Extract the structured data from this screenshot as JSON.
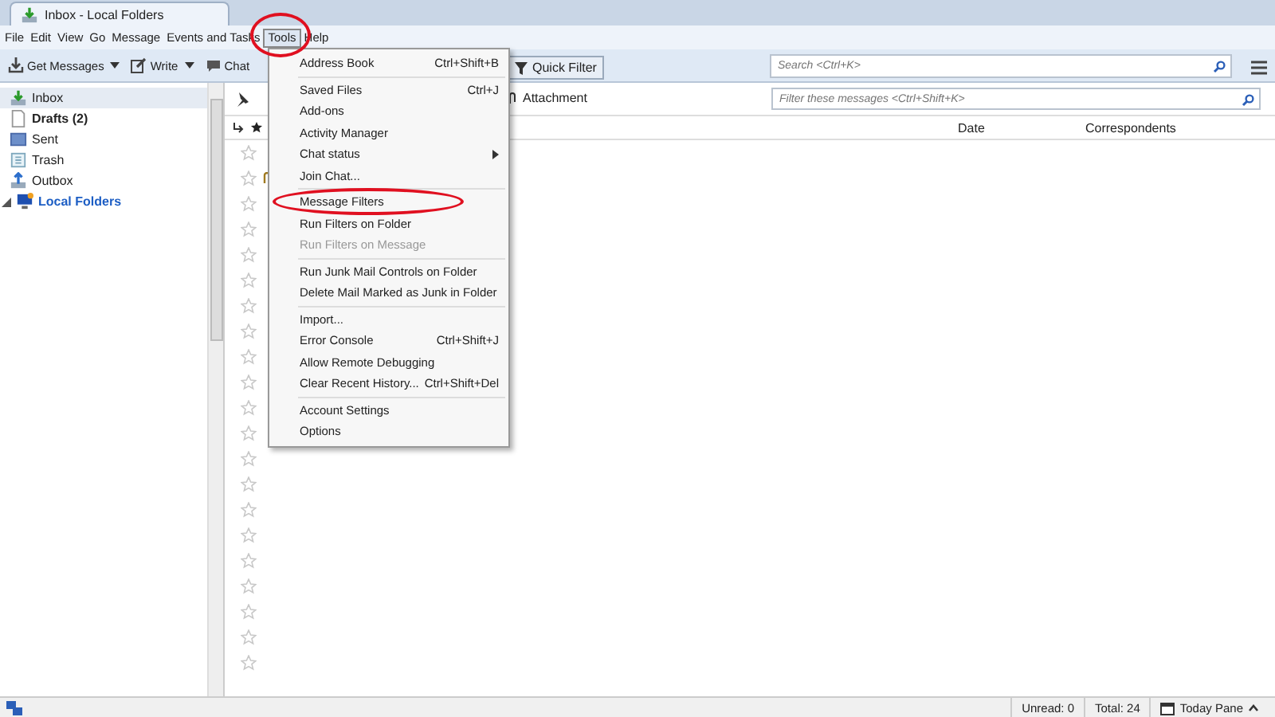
{
  "window": {
    "tab_title": "Inbox - Local Folders"
  },
  "menu_bar": [
    {
      "label": "File",
      "selected": false
    },
    {
      "label": "Edit",
      "selected": false
    },
    {
      "label": "View",
      "selected": false
    },
    {
      "label": "Go",
      "selected": false
    },
    {
      "label": "Message",
      "selected": false
    },
    {
      "label": "Events and Tasks",
      "selected": false
    },
    {
      "label": "Tools",
      "selected": true
    },
    {
      "label": "Help",
      "selected": false
    }
  ],
  "toolbar": {
    "buttons": [
      {
        "label": "Get Messages",
        "kind": "split"
      },
      {
        "label": "Write",
        "kind": "split"
      },
      {
        "label": "Chat",
        "kind": "plain"
      }
    ],
    "quick_filter": "Quick Filter",
    "search": {
      "placeholder": "Search <Ctrl+K>"
    }
  },
  "folders": [
    {
      "label": "Inbox",
      "selected": true,
      "bold": false
    },
    {
      "label": "Drafts (2)",
      "selected": false,
      "bold": true
    },
    {
      "label": "Sent",
      "selected": false,
      "bold": false
    },
    {
      "label": "Trash",
      "selected": false,
      "bold": false
    },
    {
      "label": "Outbox",
      "selected": false,
      "bold": false
    },
    {
      "label": "Local Folders",
      "selected": false,
      "bold": true,
      "expanded": true
    }
  ],
  "filter_bar": {
    "attachment": "Attachment",
    "filter": {
      "placeholder": "Filter these messages <Ctrl+Shift+K>"
    }
  },
  "columns": [
    {
      "label": "Date"
    },
    {
      "label": "Correspondents"
    }
  ],
  "message_rows": [
    {
      "starred": false,
      "attachment": false
    },
    {
      "starred": false,
      "attachment": true
    },
    {
      "starred": false,
      "attachment": false
    },
    {
      "starred": false,
      "attachment": false
    },
    {
      "starred": false,
      "attachment": false
    },
    {
      "starred": false,
      "attachment": false
    },
    {
      "starred": false,
      "attachment": false
    },
    {
      "starred": false,
      "attachment": false
    },
    {
      "starred": false,
      "attachment": false
    },
    {
      "starred": false,
      "attachment": false
    },
    {
      "starred": false,
      "attachment": false
    },
    {
      "starred": false,
      "attachment": false
    },
    {
      "starred": false,
      "attachment": false
    },
    {
      "starred": false,
      "attachment": false
    },
    {
      "starred": false,
      "attachment": false
    },
    {
      "starred": false,
      "attachment": false
    },
    {
      "starred": false,
      "attachment": false
    },
    {
      "starred": false,
      "attachment": false
    },
    {
      "starred": false,
      "attachment": false
    },
    {
      "starred": false,
      "attachment": false
    },
    {
      "starred": false,
      "attachment": false
    }
  ],
  "tools_menu": [
    {
      "label": "Address Book",
      "shortcut": "Ctrl+Shift+B",
      "disabled": false,
      "submenu": false,
      "highlighted": false,
      "separator_after": true
    },
    {
      "label": "Saved Files",
      "shortcut": "Ctrl+J",
      "disabled": false,
      "submenu": false,
      "highlighted": false,
      "separator_after": false
    },
    {
      "label": "Add-ons",
      "disabled": false,
      "submenu": false,
      "highlighted": false,
      "separator_after": false
    },
    {
      "label": "Activity Manager",
      "disabled": false,
      "submenu": false,
      "highlighted": false,
      "separator_after": false
    },
    {
      "label": "Chat status",
      "disabled": false,
      "submenu": true,
      "highlighted": false,
      "separator_after": false
    },
    {
      "label": "Join Chat...",
      "disabled": false,
      "submenu": false,
      "highlighted": false,
      "separator_after": true
    },
    {
      "label": "Message Filters",
      "disabled": false,
      "submenu": false,
      "highlighted": true,
      "separator_after": false
    },
    {
      "label": "Run Filters on Folder",
      "disabled": false,
      "submenu": false,
      "highlighted": false,
      "separator_after": false
    },
    {
      "label": "Run Filters on Message",
      "disabled": true,
      "submenu": false,
      "highlighted": false,
      "separator_after": true
    },
    {
      "label": "Run Junk Mail Controls on Folder",
      "disabled": false,
      "submenu": false,
      "highlighted": false,
      "separator_after": false
    },
    {
      "label": "Delete Mail Marked as Junk in Folder",
      "disabled": false,
      "submenu": false,
      "highlighted": false,
      "separator_after": true
    },
    {
      "label": "Import...",
      "disabled": false,
      "submenu": false,
      "highlighted": false,
      "separator_after": false
    },
    {
      "label": "Error Console",
      "shortcut": "Ctrl+Shift+J",
      "disabled": false,
      "submenu": false,
      "highlighted": false,
      "separator_after": false
    },
    {
      "label": "Allow Remote Debugging",
      "disabled": false,
      "submenu": false,
      "highlighted": false,
      "separator_after": false
    },
    {
      "label": "Clear Recent History...",
      "shortcut": "Ctrl+Shift+Del",
      "disabled": false,
      "submenu": false,
      "highlighted": false,
      "separator_after": true
    },
    {
      "label": "Account Settings",
      "disabled": false,
      "submenu": false,
      "highlighted": false,
      "separator_after": false
    },
    {
      "label": "Options",
      "disabled": false,
      "submenu": false,
      "highlighted": false,
      "separator_after": false
    }
  ],
  "status_bar": {
    "unread": "Unread: 0",
    "total": "Total: 24",
    "today_pane": "Today Pane"
  }
}
